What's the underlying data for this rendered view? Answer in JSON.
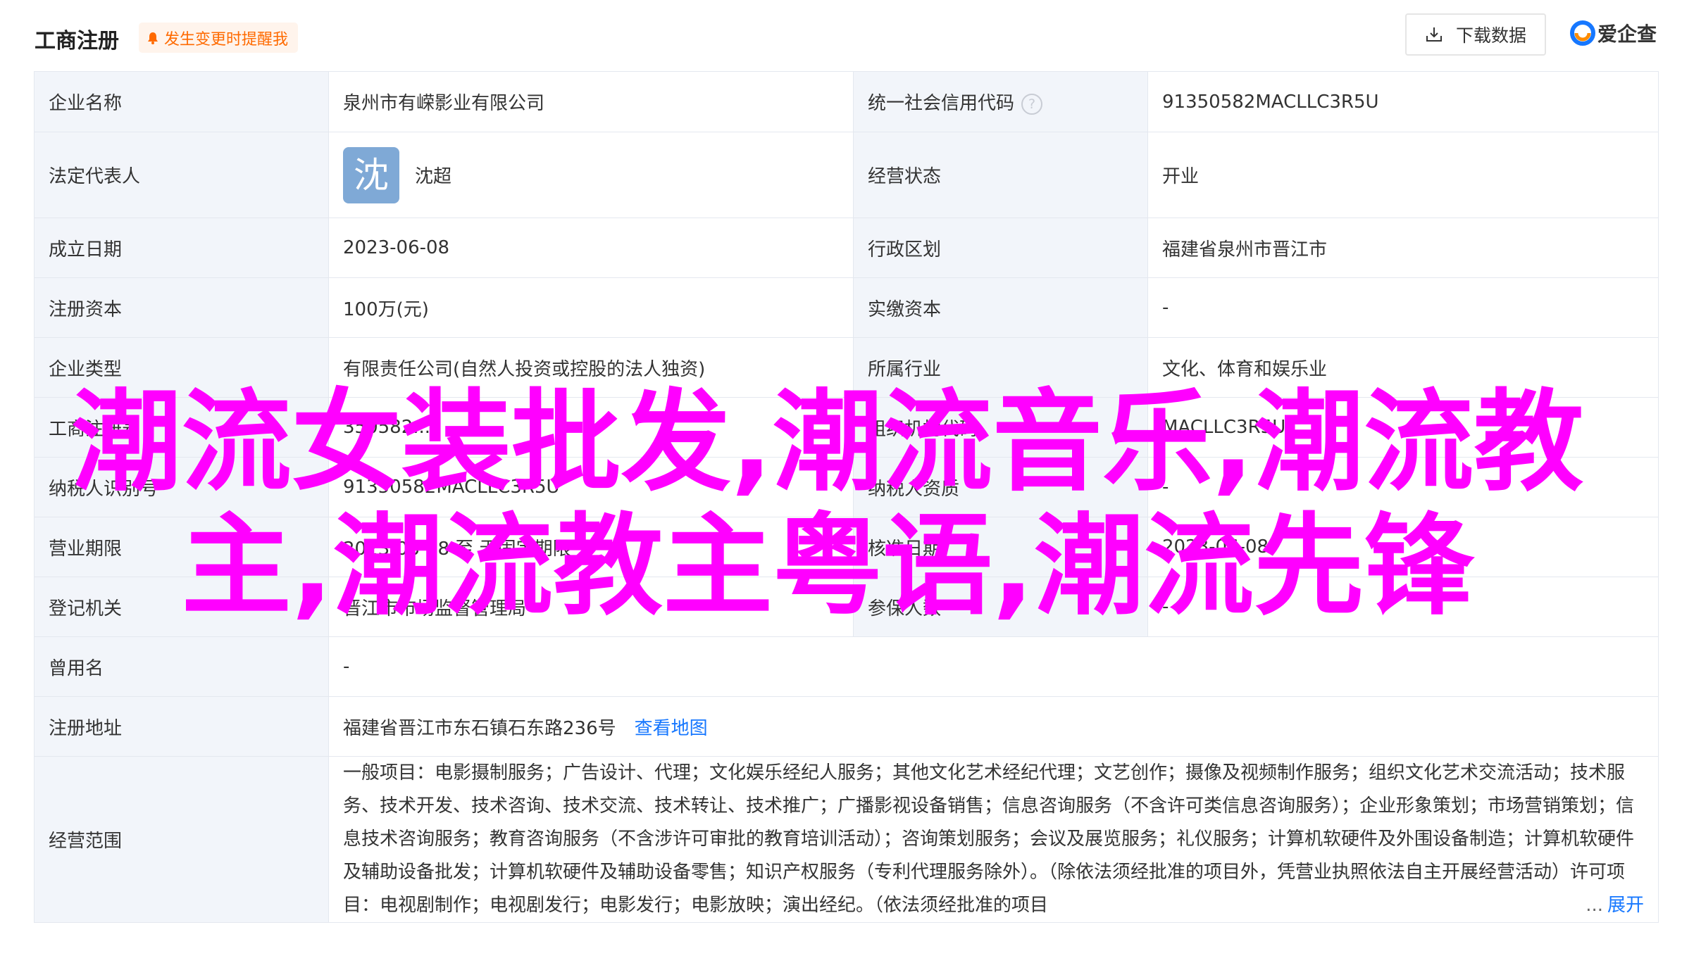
{
  "header": {
    "title": "工商注册",
    "alert_label": "发生变更时提醒我",
    "download_label": "下载数据",
    "logo_text": "爱企查"
  },
  "rows": {
    "r1": {
      "l1": "企业名称",
      "v1": "泉州市有嵘影业有限公司",
      "l2": "统一社会信用代码",
      "v2": "91350582MACLLC3R5U"
    },
    "r2": {
      "l1": "法定代表人",
      "avatar_char": "沈",
      "v1": "沈超",
      "l2": "经营状态",
      "v2": "开业"
    },
    "r3": {
      "l1": "成立日期",
      "v1": "2023-06-08",
      "l2": "行政区划",
      "v2": "福建省泉州市晋江市"
    },
    "r4": {
      "l1": "注册资本",
      "v1": "100万(元)",
      "l2": "实缴资本",
      "v2": "-"
    },
    "r5": {
      "l1": "企业类型",
      "v1": "有限责任公司(自然人投资或控股的法人独资)",
      "l2": "所属行业",
      "v2": "文化、体育和娱乐业"
    },
    "r6": {
      "l1": "工商注册号",
      "v1": "350582...",
      "l2": "组织机构代码",
      "v2": "MACLLC3R5U"
    },
    "r7": {
      "l1": "纳税人识别号",
      "v1": "91350582MACLLC3R5U",
      "l2": "纳税人资质",
      "v2": "-"
    },
    "r8": {
      "l1": "营业期限",
      "v1": "2023-06-08 至 无固定期限",
      "l2": "核准日期",
      "v2": "2023-06-08"
    },
    "r9": {
      "l1": "登记机关",
      "v1": "晋江市市场监督管理局",
      "l2": "参保人数",
      "v2": "-"
    },
    "r10": {
      "l1": "曾用名",
      "v1": "-"
    },
    "r11": {
      "l1": "注册地址",
      "v1": "福建省晋江市东石镇石东路236号",
      "link": "查看地图"
    },
    "r12": {
      "l1": "经营范围",
      "v1": "一般项目：电影摄制服务；广告设计、代理；文化娱乐经纪人服务；其他文化艺术经纪代理；文艺创作；摄像及视频制作服务；组织文化艺术交流活动；技术服务、技术开发、技术咨询、技术交流、技术转让、技术推广；广播影视设备销售；信息咨询服务（不含许可类信息咨询服务）；企业形象策划；市场营销策划；信息技术咨询服务；教育咨询服务（不含涉许可审批的教育培训活动）；咨询策划服务；会议及展览服务；礼仪服务；计算机软硬件及外围设备制造；计算机软硬件及辅助设备批发；计算机软硬件及辅助设备零售；知识产权服务（专利代理服务除外）。（除依法须经批准的项目外，凭营业执照依法自主开展经营活动）许可项目：电视剧制作；电视剧发行；电影发行；电影放映；演出经纪。（依法须经批准的项目",
      "more": "...",
      "expand": "展开"
    }
  },
  "overlay": {
    "line1": "潮流女装批发,潮流音乐,潮流教",
    "line2": "主,潮流教主粤语,潮流先锋"
  },
  "colors": {
    "accent": "#1677ff",
    "alert": "#ff6a00",
    "overlay": "#ff00ff",
    "label_bg": "#f2f5fa"
  },
  "icons": [
    "bell-icon",
    "download-icon",
    "help-icon",
    "aiqicha-logo-icon"
  ]
}
